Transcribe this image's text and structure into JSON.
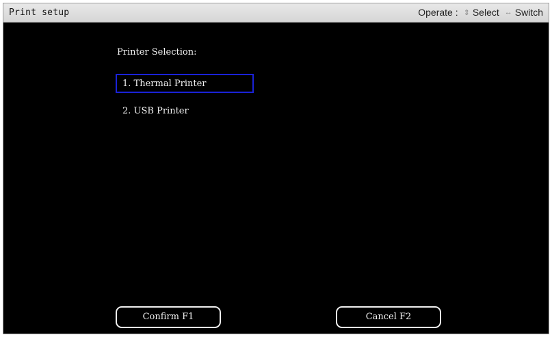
{
  "window": {
    "title": "Print setup"
  },
  "hints": {
    "operate_label": "Operate :",
    "select_label": "Select",
    "switch_label": "Switch",
    "select_icon": "arrow-updown-icon",
    "switch_icon": "arrow-leftright-icon"
  },
  "printer_selection": {
    "label": "Printer Selection:",
    "selected_index": 0,
    "options": [
      {
        "label": "1. Thermal Printer"
      },
      {
        "label": "2. USB Printer"
      }
    ]
  },
  "buttons": {
    "confirm_label": "Confirm F1",
    "cancel_label": "Cancel F2"
  },
  "colors": {
    "background": "#000000",
    "title_bar": "#dcdcdc",
    "selection_border": "#1a22d8",
    "text": "#f2f2f2"
  }
}
